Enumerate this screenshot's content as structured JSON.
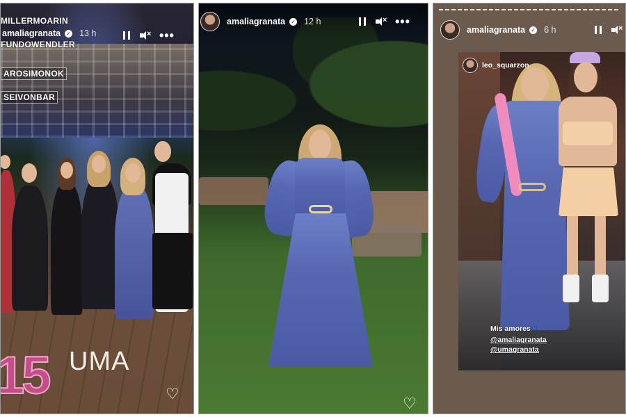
{
  "panel_left": {
    "tags": [
      "MILLERMOARIN",
      "FUNDOWENDLER",
      "AROSIMONOK",
      "SEIVONBAR"
    ],
    "username": "amaliagranata",
    "time": "13 h",
    "sticker_number": "15",
    "sticker_name": "UMA",
    "icons": [
      "pause-icon",
      "mute-icon",
      "more-icon",
      "heart-icon"
    ]
  },
  "panel_middle": {
    "username": "amaliagranata",
    "time": "12 h",
    "icons": [
      "pause-icon",
      "mute-icon",
      "more-icon",
      "heart-icon"
    ]
  },
  "panel_right": {
    "username": "amaliagranata",
    "time": "6 h",
    "reshared_user": "leo_squarzon",
    "caption": "Mis amores",
    "mentions": [
      "@amaliagranata",
      "@umagranata"
    ],
    "icons": [
      "pause-icon",
      "mute-icon"
    ]
  },
  "colors": {
    "dress_blue": "#5666b0",
    "balloon_pink": "#c64d8a",
    "heart_blue": "#3d6fe0"
  }
}
